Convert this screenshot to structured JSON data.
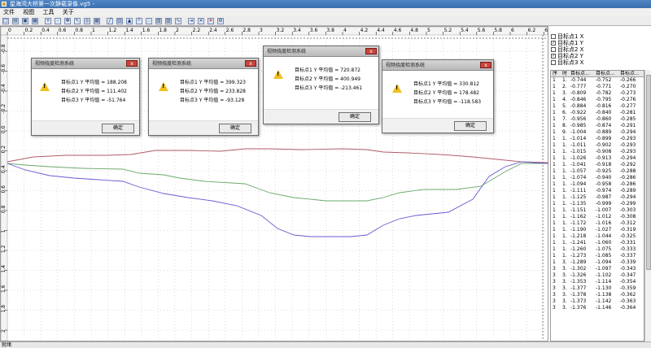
{
  "app": {
    "title": "星海湾大桥第一次静载录像.vg5 -"
  },
  "menu": [
    "文件",
    "视图",
    "工具",
    "关于"
  ],
  "toolbar": {
    "icons": [
      "new-icon",
      "open-icon",
      "save-icon",
      "print-icon",
      "zoom-in-icon",
      "zoom-out-icon",
      "pan-icon",
      "arrow-icon",
      "target-icon",
      "grid-icon",
      "line-chart-icon",
      "bar-chart-icon",
      "area-chart-icon",
      "step-chart-icon",
      "scatter-chart-icon",
      "chart-icon",
      "chart-alt-icon",
      "curve-icon",
      "export-icon",
      "close-x-icon",
      "close-x-red-icon",
      "settings-icon"
    ]
  },
  "axes": {
    "x_ticks": [
      "0",
      "0.2",
      "0.4",
      "0.6",
      "0.8",
      "1",
      "1.2",
      "1.4",
      "1.6",
      "1.8",
      "2",
      "2.2",
      "2.4",
      "2.6",
      "2.8",
      "3",
      "3.2",
      "3.4",
      "3.6",
      "3.8",
      "4",
      "4.2",
      "4.4",
      "4.6",
      "4.8",
      "5",
      "5.2",
      "5.4",
      "5.6",
      "5.8",
      "6",
      "6.2",
      "6.4"
    ],
    "y_ticks": [
      "-0.8",
      "-0.6",
      "-0.4",
      "-0.2",
      "0.0",
      "0.2",
      "0.4",
      "0.6",
      "0.8",
      "1",
      "1.2",
      "1.4",
      "1.6",
      "1.8",
      "2"
    ]
  },
  "dialogs": [
    {
      "title": "视频挠度检测系统",
      "lines": [
        "目标点1 Y  平均值 = 188.208",
        "目标点2 Y  平均值 = 111.402",
        "目标点3 Y  平均值 = -51.764"
      ],
      "ok": "确定"
    },
    {
      "title": "视频挠度检测系统",
      "lines": [
        "目标点1 Y  平均值 = 399.323",
        "目标点2 Y  平均值 = 233.828",
        "目标点3 Y  平均值 = -93.128"
      ],
      "ok": "确定"
    },
    {
      "title": "视频挠度检测系统",
      "lines": [
        "目标点1 Y  平均值 = 720.872",
        "目标点2 Y  平均值 = 400.949",
        "目标点3 Y  平均值 = -213.461"
      ],
      "ok": "确定"
    },
    {
      "title": "视频挠度检测系统",
      "lines": [
        "目标点1 Y  平均值 = 330.812",
        "目标点2 Y  平均值 = 178.482",
        "目标点3 Y  平均值 = -118.583"
      ],
      "ok": "确定"
    }
  ],
  "legend": [
    {
      "label": "目标点1 X",
      "checked": false
    },
    {
      "label": "目标点1 Y",
      "checked": true
    },
    {
      "label": "目标点2 X",
      "checked": false
    },
    {
      "label": "目标点2 Y",
      "checked": true
    },
    {
      "label": "目标点3 X",
      "checked": false
    }
  ],
  "table": {
    "headers": [
      "序",
      "时",
      "目标点...",
      "目标点...",
      "目标点..."
    ],
    "rows": [
      [
        "1",
        "1.",
        "-0.744",
        "-0.752",
        "-0.266"
      ],
      [
        "1",
        "2.",
        "-0.777",
        "-0.771",
        "-0.270"
      ],
      [
        "1",
        "3.",
        "-0.809",
        "-0.782",
        "-0.273"
      ],
      [
        "1",
        "4.",
        "-0.846",
        "-0.795",
        "-0.276"
      ],
      [
        "1",
        "5.",
        "-0.884",
        "-0.816",
        "-0.277"
      ],
      [
        "1",
        "6.",
        "-0.922",
        "-0.840",
        "-0.281"
      ],
      [
        "1",
        "7.",
        "-0.956",
        "-0.860",
        "-0.285"
      ],
      [
        "1",
        "8.",
        "-0.985",
        "-0.874",
        "-0.291"
      ],
      [
        "1",
        "9.",
        "-1.004",
        "-0.889",
        "-0.294"
      ],
      [
        "1",
        "1.",
        "-1.014",
        "-0.899",
        "-0.293"
      ],
      [
        "1",
        "1.",
        "-1.011",
        "-0.902",
        "-0.293"
      ],
      [
        "1",
        "1.",
        "-1.015",
        "-0.908",
        "-0.293"
      ],
      [
        "1",
        "1.",
        "-1.026",
        "-0.913",
        "-0.294"
      ],
      [
        "1",
        "1.",
        "-1.041",
        "-0.918",
        "-0.292"
      ],
      [
        "1",
        "1.",
        "-1.057",
        "-0.925",
        "-0.288"
      ],
      [
        "1",
        "1.",
        "-1.074",
        "-0.940",
        "-0.286"
      ],
      [
        "1",
        "1.",
        "-1.094",
        "-0.958",
        "-0.286"
      ],
      [
        "1",
        "1.",
        "-1.111",
        "-0.974",
        "-0.289"
      ],
      [
        "1",
        "1.",
        "-1.125",
        "-0.987",
        "-0.294"
      ],
      [
        "1",
        "1.",
        "-1.135",
        "-0.999",
        "-0.299"
      ],
      [
        "1",
        "1.",
        "-1.151",
        "-1.007",
        "-0.303"
      ],
      [
        "1",
        "1.",
        "-1.162",
        "-1.012",
        "-0.308"
      ],
      [
        "1",
        "1.",
        "-1.172",
        "-1.016",
        "-0.312"
      ],
      [
        "1",
        "1.",
        "-1.190",
        "-1.027",
        "-0.319"
      ],
      [
        "1",
        "1.",
        "-1.218",
        "-1.044",
        "-0.325"
      ],
      [
        "1",
        "1.",
        "-1.241",
        "-1.060",
        "-0.331"
      ],
      [
        "1",
        "1.",
        "-1.260",
        "-1.075",
        "-0.333"
      ],
      [
        "1",
        "1.",
        "-1.273",
        "-1.085",
        "-0.337"
      ],
      [
        "1",
        "3.",
        "-1.289",
        "-1.094",
        "-0.339"
      ],
      [
        "3",
        "3.",
        "-1.302",
        "-1.097",
        "-0.343"
      ],
      [
        "3",
        "3.",
        "-1.326",
        "-1.102",
        "-0.347"
      ],
      [
        "3",
        "3.",
        "-1.353",
        "-1.114",
        "-0.354"
      ],
      [
        "3",
        "3.",
        "-1.377",
        "-1.130",
        "-0.359"
      ],
      [
        "3",
        "3.",
        "-1.378",
        "-1.138",
        "-0.362"
      ],
      [
        "3",
        "3.",
        "-1.373",
        "-1.142",
        "-0.363"
      ],
      [
        "3",
        "3.",
        "-1.376",
        "-1.146",
        "-0.364"
      ]
    ]
  },
  "status": "就绪",
  "colors": {
    "series1": "#b05a6a",
    "series2": "#6aa86a",
    "series3": "#6a5ad0"
  }
}
